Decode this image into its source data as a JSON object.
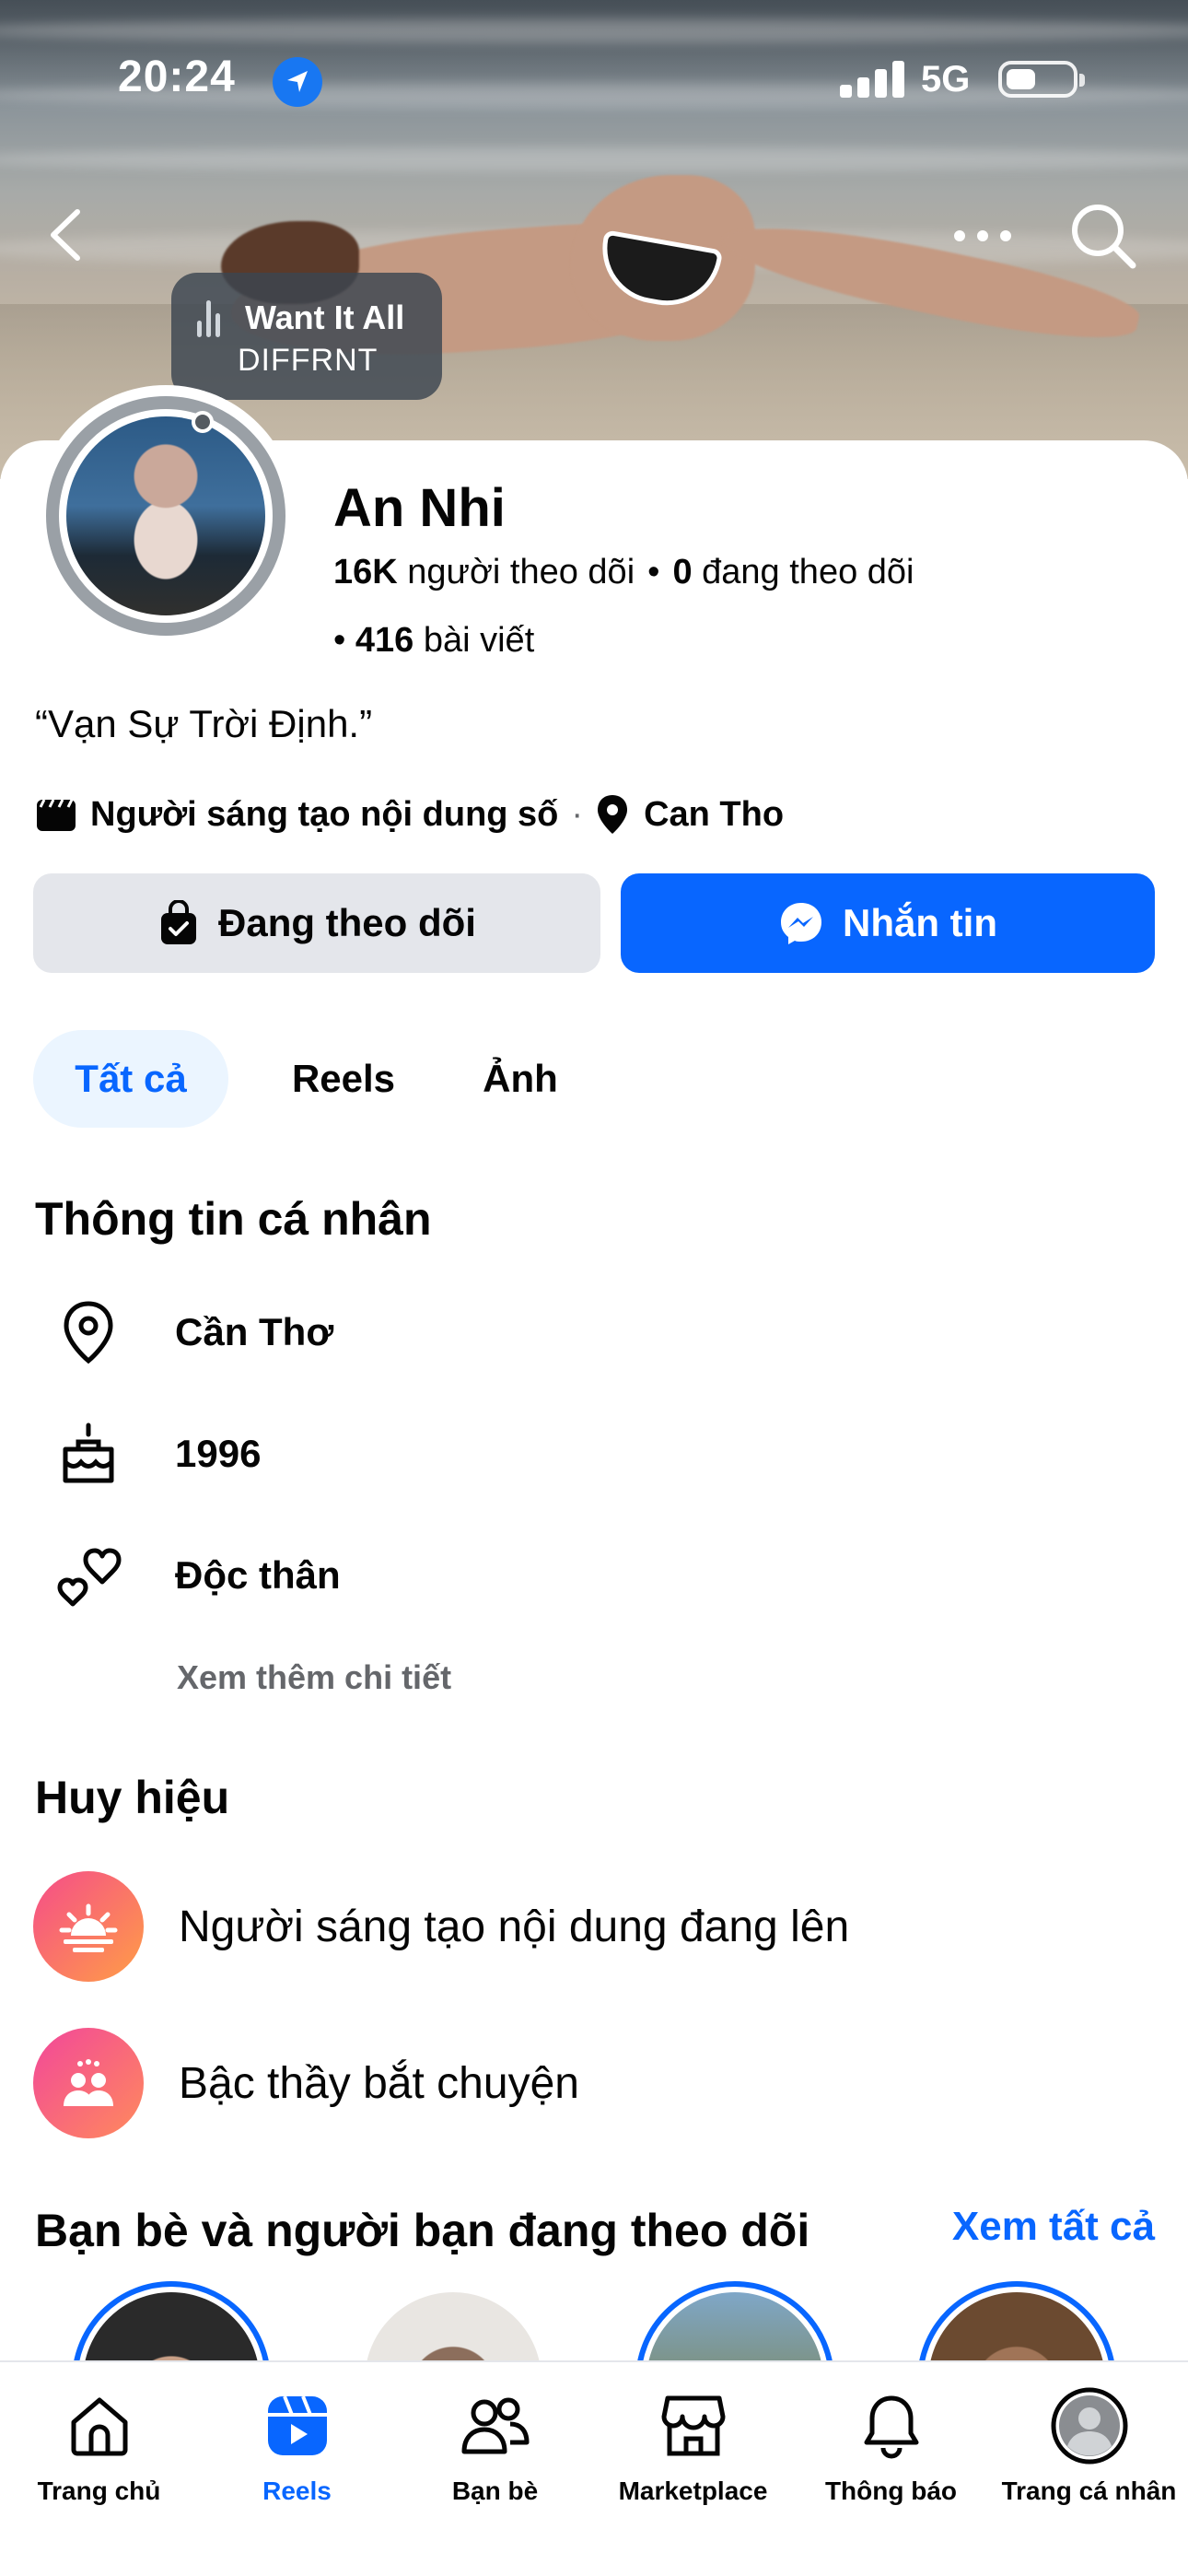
{
  "status_bar": {
    "time": "20:24",
    "network": "5G",
    "battery_level": 0.45,
    "signal_bars": 4
  },
  "header": {
    "back_icon": "chevron-left-icon",
    "more_icon": "more-horizontal-icon",
    "search_icon": "search-icon"
  },
  "music_tag": {
    "title": "Want It All",
    "artist": "DIFFRNT"
  },
  "profile": {
    "name": "An Nhi",
    "followers_count": "16K",
    "followers_label": "người theo dõi",
    "following_count": "0",
    "following_label": "đang theo dõi",
    "posts_count": "416",
    "posts_label": "bài viết",
    "bio": "“Vạn Sự Trời Định.”",
    "category": "Người sáng tạo nội dung số",
    "location": "Can Tho"
  },
  "actions": {
    "following_label": "Đang theo dõi",
    "message_label": "Nhắn tin"
  },
  "tabs": [
    {
      "label": "Tất cả",
      "active": true
    },
    {
      "label": "Reels",
      "active": false
    },
    {
      "label": "Ảnh",
      "active": false
    }
  ],
  "personal_info": {
    "title": "Thông tin cá nhân",
    "items": [
      {
        "icon": "location-pin-icon",
        "text": "Cần Thơ"
      },
      {
        "icon": "birthday-cake-icon",
        "text": "1996"
      },
      {
        "icon": "hearts-icon",
        "text": "Độc thân"
      }
    ],
    "see_more": "Xem thêm chi tiết"
  },
  "badges": {
    "title": "Huy hiệu",
    "items": [
      {
        "icon": "sunrise-badge-icon",
        "text": "Người sáng tạo nội dung đang lên",
        "color": "#f86b5a"
      },
      {
        "icon": "conversation-starter-icon",
        "text": "Bậc thầy bắt chuyện",
        "color": "#f4508a"
      }
    ]
  },
  "friends": {
    "title": "Bạn bè và người bạn đang theo dõi",
    "see_all": "Xem tất cả"
  },
  "bottom_nav": [
    {
      "icon": "home-icon",
      "label": "Trang chủ",
      "active": false
    },
    {
      "icon": "reels-icon",
      "label": "Reels",
      "active": true
    },
    {
      "icon": "friends-icon",
      "label": "Bạn bè",
      "active": false
    },
    {
      "icon": "marketplace-icon",
      "label": "Marketplace",
      "active": false
    },
    {
      "icon": "bell-icon",
      "label": "Thông báo",
      "active": false
    },
    {
      "icon": "profile-avatar-icon",
      "label": "Trang cá nhân",
      "active": false
    }
  ],
  "colors": {
    "brand_blue": "#0866ff",
    "secondary_button": "#e4e6eb",
    "active_tab_bg": "#ebf5ff"
  }
}
